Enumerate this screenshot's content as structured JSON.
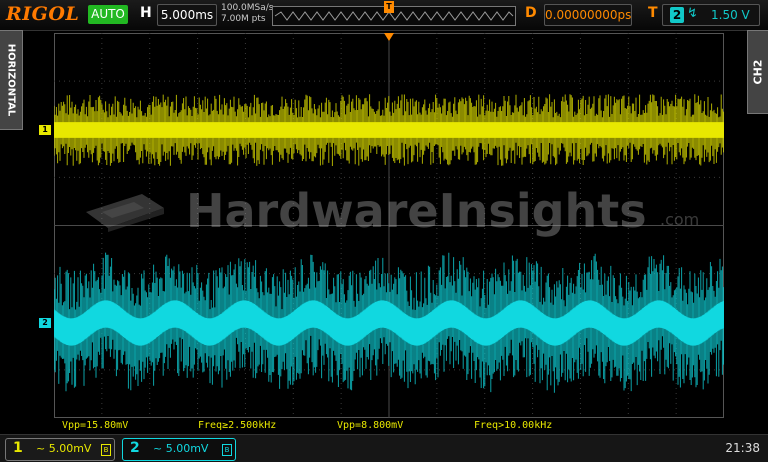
{
  "header": {
    "brand": "RIGOL",
    "run_state": "AUTO",
    "horizontal_label": "H",
    "timebase": "5.000ms",
    "sample_rate": "100.0MSa/s",
    "memory_depth": "7.00M pts",
    "trigger_position_marker": "T",
    "delay_label": "D",
    "delay_value": "0.00000000ps",
    "trigger_label": "T",
    "trigger_source": "2",
    "trigger_level": "1.50 V"
  },
  "side_tabs": {
    "left": "HORIZONTAL",
    "right": "CH2"
  },
  "screen": {
    "trigger_marker": "T",
    "ch1_marker": "1",
    "ch2_marker": "2",
    "watermark": "HardwareInsights",
    "watermark_suffix": ".com",
    "colors": {
      "ch1": "#e8e800",
      "ch2": "#11d8e0",
      "grid": "#3a3a3a",
      "trigger": "#ff8a00"
    }
  },
  "measurements": {
    "ch1_vpp": "Vpp=15.80mV",
    "ch1_freq": "Freq≥2.500kHz",
    "ch2_vpp": "Vpp=8.800mV",
    "ch2_freq": "Freq>10.00kHz"
  },
  "footer": {
    "ch1_number": "1",
    "ch1_scale": "~ 5.00mV",
    "ch1_bw_icon": "B",
    "ch2_number": "2",
    "ch2_scale": "~ 5.00mV",
    "ch2_bw_icon": "B",
    "clock": "21:38"
  }
}
